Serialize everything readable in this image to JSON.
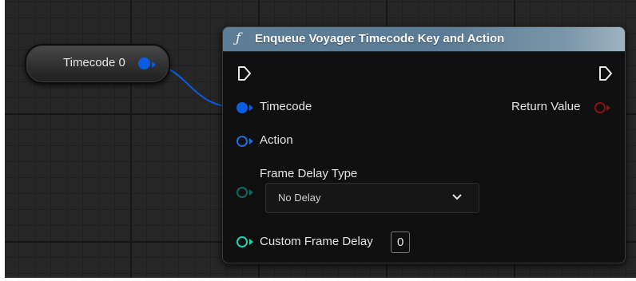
{
  "variable_node": {
    "label": "Timecode 0",
    "pin_color": "#0a5de0"
  },
  "function_node": {
    "icon": "function-icon",
    "title": "Enqueue Voyager Timecode Key and Action",
    "inputs": {
      "timecode_label": "Timecode",
      "action_label": "Action",
      "frame_delay_type_label": "Frame Delay Type",
      "frame_delay_type_value": "No Delay",
      "custom_frame_delay_label": "Custom Frame Delay",
      "custom_frame_delay_value": "0"
    },
    "outputs": {
      "return_value_label": "Return Value"
    }
  },
  "colors": {
    "struct_pin": "#0a5de0",
    "action_pin": "#1e6fe0",
    "enum_pin": "#0a6b5e",
    "int_pin": "#1ed4b0",
    "return_pin": "#8a1111",
    "header": "#5e7e97"
  }
}
